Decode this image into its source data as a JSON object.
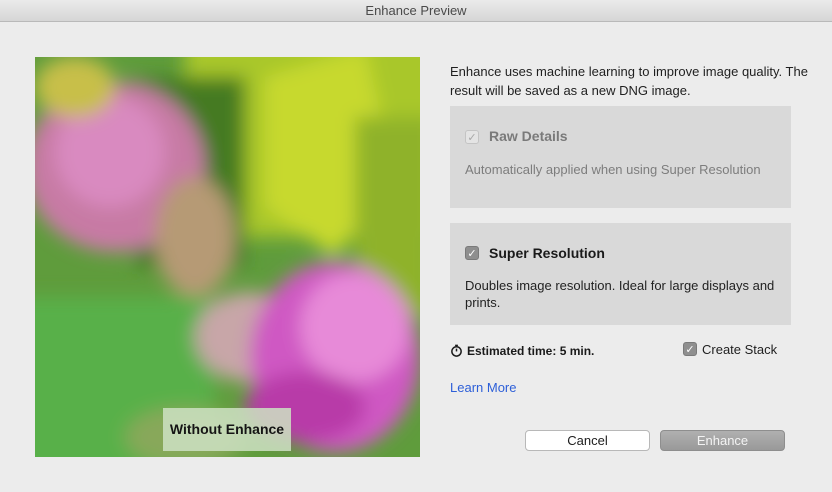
{
  "window": {
    "title": "Enhance Preview"
  },
  "preview": {
    "label": "Without Enhance"
  },
  "description": "Enhance uses machine learning to improve image quality. The result will be saved as a new DNG image.",
  "options": {
    "raw_details": {
      "title": "Raw Details",
      "checked": true,
      "enabled": false,
      "description": "Automatically applied when using Super Resolution"
    },
    "super_resolution": {
      "title": "Super Resolution",
      "checked": true,
      "enabled": true,
      "description": "Doubles image resolution. Ideal for large displays and prints."
    }
  },
  "estimate": {
    "label": "Estimated time: 5 min."
  },
  "create_stack": {
    "label": "Create Stack",
    "checked": true
  },
  "learn_more": "Learn More",
  "buttons": {
    "cancel": "Cancel",
    "enhance": "Enhance"
  },
  "colors": {
    "link": "#2d5fd8",
    "panel": "#d9d9d9",
    "window": "#ececec"
  },
  "icons": {
    "checkmark": "checkmark-icon",
    "timer": "stopwatch-icon"
  }
}
